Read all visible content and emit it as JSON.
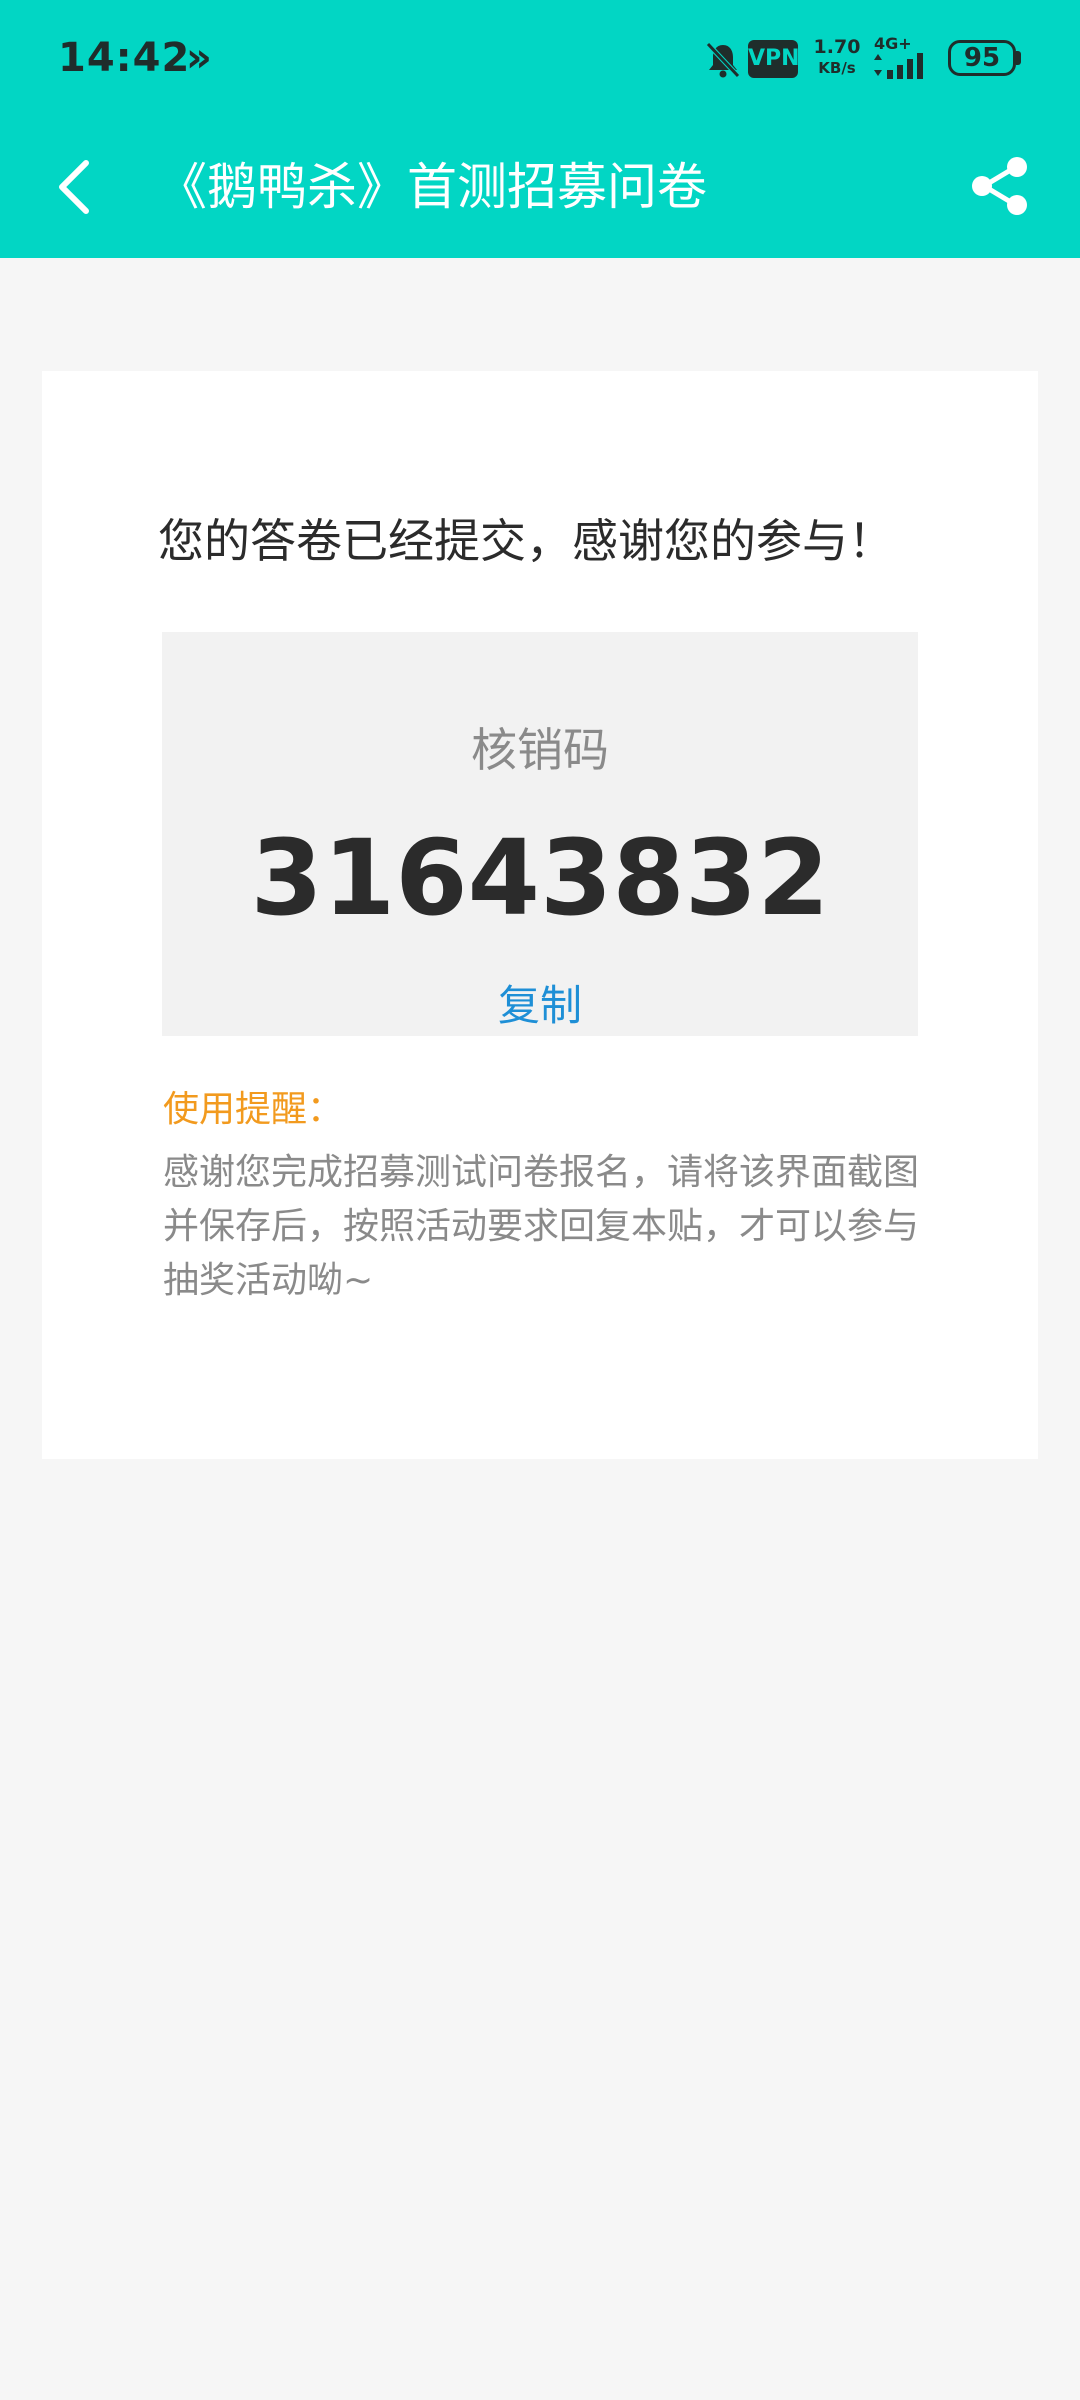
{
  "status_bar": {
    "time": "14:42",
    "more_indicator": "»",
    "vpn_label": "VPN",
    "net_speed_value": "1.70",
    "net_speed_unit": "KB/s",
    "network_type": "4G+",
    "battery": "95",
    "icons": [
      "bell-muted-icon",
      "signal-icon",
      "battery-icon"
    ]
  },
  "header": {
    "title": "《鹅鸭杀》首测招募问卷",
    "back_icon": "back-icon",
    "share_icon": "share-icon",
    "background_color": "#02d6c4"
  },
  "result": {
    "message": "您的答卷已经提交，感谢您的参与！",
    "code_label": "核销码",
    "code_value": "31643832",
    "copy_label": "复制"
  },
  "reminder": {
    "title": "使用提醒：",
    "text": "感谢您完成招募测试问卷报名，请将该界面截图并保存后，按照活动要求回复本贴，才可以参与抽奖活动呦~"
  },
  "colors": {
    "accent": "#02d6c4",
    "link": "#1e8fd6",
    "warning": "#f29a1e"
  }
}
